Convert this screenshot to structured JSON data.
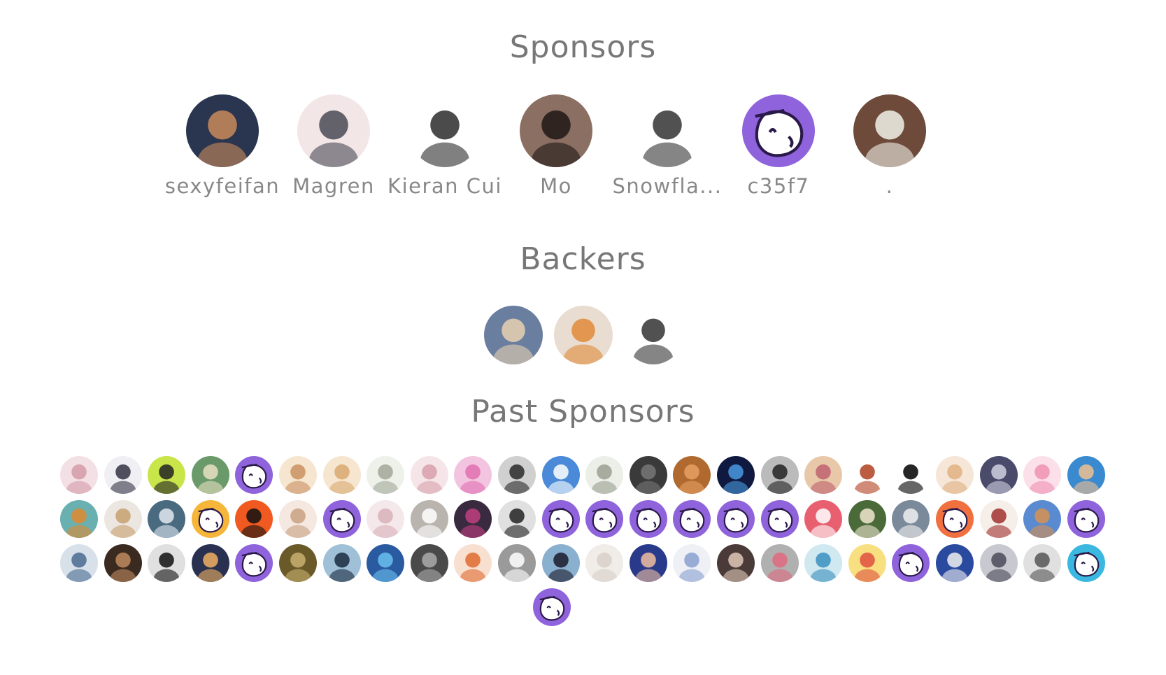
{
  "sections": {
    "sponsors_title": "Sponsors",
    "backers_title": "Backers",
    "past_sponsors_title": "Past Sponsors"
  },
  "sponsors": [
    {
      "name": "sexyfeifan",
      "icon": "boy-portrait-avatar",
      "bg": "#2a3550",
      "fg": "#c98a5a"
    },
    {
      "name": "Magren",
      "icon": "red-scarf-cat-avatar",
      "bg": "#f2e6e6",
      "fg": "#4a4a55"
    },
    {
      "name": "Kieran Cui",
      "icon": "glasses-man-avatar",
      "bg": "#ffffff",
      "fg": "#2b2b2b"
    },
    {
      "name": "Mo",
      "icon": "woman-photo-avatar",
      "bg": "#8a6f62",
      "fg": "#201816"
    },
    {
      "name": "Snowfla...",
      "icon": "sketch-cat-avatar",
      "bg": "#ffffff",
      "fg": "#333333"
    },
    {
      "name": "c35f7",
      "icon": "default-blob-avatar",
      "bg": "#8f63db",
      "fg": "#ffffff"
    },
    {
      "name": ".",
      "icon": "polar-bear-avatar",
      "bg": "#6e4a3a",
      "fg": "#f2f2ea"
    }
  ],
  "backers": [
    {
      "icon": "anime-girl-avatar",
      "bg": "#6a7ea0",
      "fg": "#e8d0b0"
    },
    {
      "icon": "boy-with-cat-avatar",
      "bg": "#e8ddd0",
      "fg": "#e08a3a"
    },
    {
      "icon": "computer-user-sketch-avatar",
      "bg": "#ffffff",
      "fg": "#333333"
    }
  ],
  "past_sponsors": [
    {
      "icon": "anime-pink-girl-avatar",
      "bg": "#f3e0e4",
      "fg": "#d49aa8"
    },
    {
      "icon": "anime-dark-hair-avatar",
      "bg": "#f0f0f4",
      "fg": "#333344"
    },
    {
      "icon": "man-glasses-green-avatar",
      "bg": "#c8e64a",
      "fg": "#222222"
    },
    {
      "icon": "green-hat-girl-avatar",
      "bg": "#6a9a6a",
      "fg": "#e8e0c0"
    },
    {
      "icon": "default-blob-avatar",
      "bg": "#8f63db",
      "fg": "#ffffff"
    },
    {
      "icon": "blonde-girl-avatar",
      "bg": "#f6e6d0",
      "fg": "#c99060"
    },
    {
      "icon": "blonde-girl-avatar",
      "bg": "#f6e6d0",
      "fg": "#d8a870"
    },
    {
      "icon": "silver-hair-girl-avatar",
      "bg": "#eef0ea",
      "fg": "#a0a898"
    },
    {
      "icon": "anime-pink-girl-avatar",
      "bg": "#f5e5e8",
      "fg": "#d8a0aa"
    },
    {
      "icon": "pink-flower-girl-avatar",
      "bg": "#f3c4e0",
      "fg": "#e070b0"
    },
    {
      "icon": "dark-hair-warrior-avatar",
      "bg": "#d0d0d0",
      "fg": "#2a2a2a"
    },
    {
      "icon": "blue-hair-avatar",
      "bg": "#4a8ad8",
      "fg": "#ffffff"
    },
    {
      "icon": "silver-hair-girl-avatar",
      "bg": "#eceee8",
      "fg": "#9aa090"
    },
    {
      "icon": "gorilla-avatar",
      "bg": "#3a3a3a",
      "fg": "#777777"
    },
    {
      "icon": "orange-cat-avatar",
      "bg": "#b06a30",
      "fg": "#e8a060"
    },
    {
      "icon": "night-figure-avatar",
      "bg": "#101a40",
      "fg": "#4a9ae0"
    },
    {
      "icon": "penguin-avatar",
      "bg": "#bbbbbb",
      "fg": "#222222"
    },
    {
      "icon": "cupcake-avatar",
      "bg": "#e8c8a8",
      "fg": "#c06070"
    },
    {
      "icon": "red-dragon-avatar",
      "bg": "#ffffff",
      "fg": "#b04020"
    },
    {
      "icon": "black-ring-logo-avatar",
      "bg": "#ffffff",
      "fg": "#000000"
    },
    {
      "icon": "blonde-boy-avatar",
      "bg": "#f5e6d8",
      "fg": "#e0b080"
    },
    {
      "icon": "dark-anime-avatar",
      "bg": "#4a4a6a",
      "fg": "#d0d0e0"
    },
    {
      "icon": "pink-hair-girl-avatar",
      "bg": "#fbe0ea",
      "fg": "#f090b0"
    },
    {
      "icon": "cartoon-boy-avatar",
      "bg": "#3a8ad0",
      "fg": "#f0c090"
    },
    {
      "icon": "tiger-avatar",
      "bg": "#6ab0b0",
      "fg": "#e08a30"
    },
    {
      "icon": "fox-girl-avatar",
      "bg": "#ece6e0",
      "fg": "#c8a070"
    },
    {
      "icon": "blue-scene-avatar",
      "bg": "#4a6a80",
      "fg": "#e0e8f0"
    },
    {
      "icon": "default-blob-avatar",
      "bg": "#f5b63a",
      "fg": "#ffffff"
    },
    {
      "icon": "black-hair-orange-avatar",
      "bg": "#f05a20",
      "fg": "#111111"
    },
    {
      "icon": "long-hair-girl-avatar",
      "bg": "#f4e8e0",
      "fg": "#c8a080"
    },
    {
      "icon": "default-blob-avatar",
      "bg": "#8f63db",
      "fg": "#ffffff"
    },
    {
      "icon": "pale-flower-avatar",
      "bg": "#f4e8ea",
      "fg": "#d8b0b8"
    },
    {
      "icon": "grey-mist-avatar",
      "bg": "#bab4ae",
      "fg": "#ffffff"
    },
    {
      "icon": "purple-mecha-avatar",
      "bg": "#3a2a40",
      "fg": "#c04080"
    },
    {
      "icon": "lone-figure-avatar",
      "bg": "#e0e0e0",
      "fg": "#222222"
    },
    {
      "icon": "default-blob-avatar",
      "bg": "#8f63db",
      "fg": "#ffffff"
    },
    {
      "icon": "default-blob-avatar",
      "bg": "#8f63db",
      "fg": "#ffffff"
    },
    {
      "icon": "default-blob-avatar",
      "bg": "#8f63db",
      "fg": "#ffffff"
    },
    {
      "icon": "default-blob-avatar",
      "bg": "#8f63db",
      "fg": "#ffffff"
    },
    {
      "icon": "default-blob-avatar",
      "bg": "#8f63db",
      "fg": "#ffffff"
    },
    {
      "icon": "default-blob-avatar",
      "bg": "#8f63db",
      "fg": "#ffffff"
    },
    {
      "icon": "pink-cross-avatar",
      "bg": "#e86070",
      "fg": "#ffffff"
    },
    {
      "icon": "hamster-avatar",
      "bg": "#4a6a3a",
      "fg": "#f0e6d0"
    },
    {
      "icon": "white-hair-avatar",
      "bg": "#7a8a9a",
      "fg": "#f0f0f0"
    },
    {
      "icon": "default-blob-avatar",
      "bg": "#f07040",
      "fg": "#ffffff"
    },
    {
      "icon": "red-hair-girl-avatar",
      "bg": "#f6eee8",
      "fg": "#a03030"
    },
    {
      "icon": "shiba-avatar",
      "bg": "#5a8ad0",
      "fg": "#d89050"
    },
    {
      "icon": "default-blob-avatar",
      "bg": "#8f63db",
      "fg": "#ffffff"
    },
    {
      "icon": "silver-anime-avatar",
      "bg": "#d8e0ea",
      "fg": "#4a6a90"
    },
    {
      "icon": "boy-photo-avatar",
      "bg": "#3a2a20",
      "fg": "#c08a60"
    },
    {
      "icon": "panda-avatar",
      "bg": "#e0e0e0",
      "fg": "#111111"
    },
    {
      "icon": "sunset-avatar",
      "bg": "#2a3050",
      "fg": "#f0b060"
    },
    {
      "icon": "default-blob-avatar",
      "bg": "#8f63db",
      "fg": "#ffffff"
    },
    {
      "icon": "forest-girl-avatar",
      "bg": "#6a5a2a",
      "fg": "#c8b070"
    },
    {
      "icon": "short-hair-girl-avatar",
      "bg": "#a0c0d8",
      "fg": "#1a2a40"
    },
    {
      "icon": "blue-twin-tail-avatar",
      "bg": "#2a5aa0",
      "fg": "#6ac0f0"
    },
    {
      "icon": "dark-wolf-avatar",
      "bg": "#4a4a4a",
      "fg": "#aaaaaa"
    },
    {
      "icon": "orange-hair-avatar",
      "bg": "#f8e0d0",
      "fg": "#e06a30"
    },
    {
      "icon": "white-skull-avatar",
      "bg": "#9a9a9a",
      "fg": "#ffffff"
    },
    {
      "icon": "dark-hair-back-avatar",
      "bg": "#8ab0d0",
      "fg": "#1a1a2a"
    },
    {
      "icon": "pale-lady-avatar",
      "bg": "#f0ece8",
      "fg": "#d8d0c8"
    },
    {
      "icon": "blue-eyed-avatar",
      "bg": "#2a3a8a",
      "fg": "#f0c0a0"
    },
    {
      "icon": "white-hair-blue-avatar",
      "bg": "#eef0f6",
      "fg": "#8aa0d0"
    },
    {
      "icon": "brown-hair-avatar",
      "bg": "#4a3a38",
      "fg": "#e0c8b8"
    },
    {
      "icon": "pink-glasses-avatar",
      "bg": "#b0b0b0",
      "fg": "#e06a80"
    },
    {
      "icon": "teal-hair-avatar",
      "bg": "#d0e8f0",
      "fg": "#3a90c0"
    },
    {
      "icon": "yellow-hair-avatar",
      "bg": "#f8e080",
      "fg": "#e05040"
    },
    {
      "icon": "default-blob-avatar",
      "bg": "#8f63db",
      "fg": "#ffffff"
    },
    {
      "icon": "white-hair-boy-avatar",
      "bg": "#2a4aa0",
      "fg": "#f0f0f0"
    },
    {
      "icon": "grey-hair-girl-avatar",
      "bg": "#c8c8d0",
      "fg": "#4a4a5a"
    },
    {
      "icon": "grey-cat-avatar",
      "bg": "#e0e0e0",
      "fg": "#555555"
    },
    {
      "icon": "default-blob-avatar",
      "bg": "#3ab8e0",
      "fg": "#ffffff"
    },
    {
      "icon": "default-blob-avatar",
      "bg": "#8f63db",
      "fg": "#ffffff"
    }
  ]
}
